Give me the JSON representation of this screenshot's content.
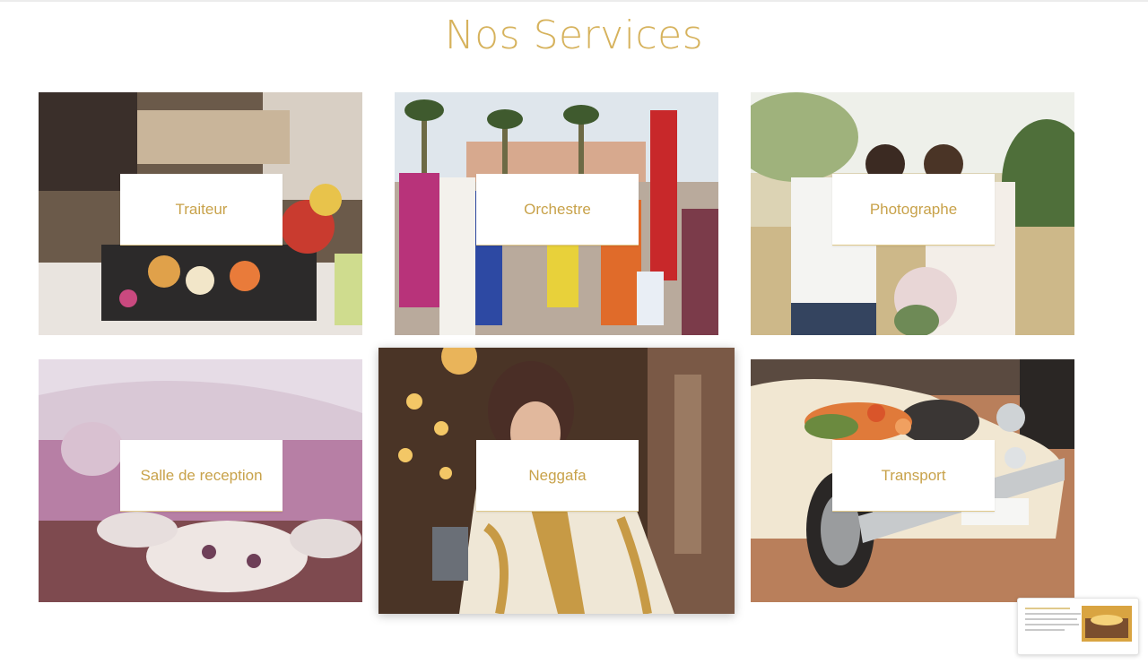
{
  "page": {
    "title": "Nos Services"
  },
  "services": [
    {
      "label": "Traiteur",
      "image": "catering-buffet-photo"
    },
    {
      "label": "Orchestre",
      "image": "traditional-musicians-photo"
    },
    {
      "label": "Photographe",
      "image": "wedding-photographer-photo"
    },
    {
      "label": "Salle de reception",
      "image": "reception-hall-photo"
    },
    {
      "label": "Neggafa",
      "image": "bride-caftan-photo"
    },
    {
      "label": "Transport",
      "image": "vintage-wedding-car-photo"
    }
  ],
  "colors": {
    "accent": "#d6b25c",
    "label": "#c8a24a",
    "background": "#ffffff"
  },
  "preview_widget": {
    "icon": "page-preview-thumbnail"
  }
}
